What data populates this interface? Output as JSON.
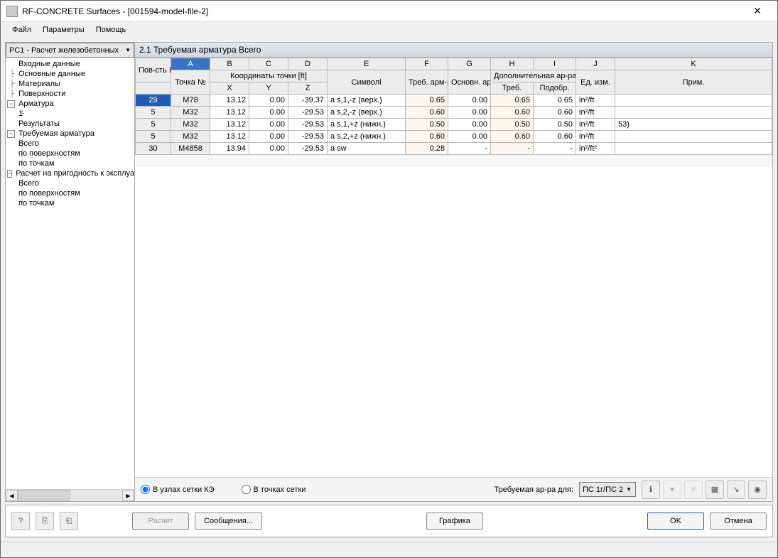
{
  "window": {
    "title": "RF-CONCRETE Surfaces - [001594-model-file-2]"
  },
  "menu": {
    "file": "Файл",
    "params": "Параметры",
    "help": "Помощь"
  },
  "sidebar": {
    "combo": "РС1 - Расчет железобетонных",
    "nodes": {
      "input": "Входные данные",
      "basic": "Основные данные",
      "materials": "Материалы",
      "surfaces": "Поверхности",
      "reinf": "Арматура",
      "reinf1": "1",
      "results": "Результаты",
      "reqreinf": "Требуемая арматура",
      "total1": "Всего",
      "bysurf1": "по поверхностям",
      "bypoint1": "по точкам",
      "service": "Расчет на пригодность к эксплуатации",
      "total2": "Всего",
      "bysurf2": "по поверхностям",
      "bypoint2": "по точкам"
    }
  },
  "panel": {
    "title": "2.1 Требуемая арматура Всего",
    "colLetters": [
      "A",
      "B",
      "C",
      "D",
      "E",
      "F",
      "G",
      "H",
      "I",
      "J",
      "K"
    ],
    "headers": {
      "surface": "Пов-сть №",
      "point": "Точка №",
      "coords": "Координаты точки [ft]",
      "X": "X",
      "Y": "Y",
      "Z": "Z",
      "symbol": "Символl",
      "reqreinf": "Треб. арм-ра",
      "basereinf": "Основн. ар-ра",
      "addreinf": "Дополнительная ар-ра",
      "addreq": "Треб.",
      "addsel": "Подобр.",
      "unit": "Ед. изм.",
      "note": "Прим."
    },
    "rows": [
      {
        "surf": "29",
        "pt": "M78",
        "x": "13.12",
        "y": "0.00",
        "z": "-39.37",
        "sym": "a s,1,-z (верх.)",
        "req": "0.65",
        "base": "0.00",
        "areq": "0.65",
        "asel": "0.65",
        "unit": "in²/ft",
        "note": ""
      },
      {
        "surf": "5",
        "pt": "M32",
        "x": "13.12",
        "y": "0.00",
        "z": "-29.53",
        "sym": "a s,2,-z (верх.)",
        "req": "0.60",
        "base": "0.00",
        "areq": "0.60",
        "asel": "0.60",
        "unit": "in²/ft",
        "note": ""
      },
      {
        "surf": "5",
        "pt": "M32",
        "x": "13.12",
        "y": "0.00",
        "z": "-29.53",
        "sym": "a s,1,+z (нижн.)",
        "req": "0.50",
        "base": "0.00",
        "areq": "0.50",
        "asel": "0.50",
        "unit": "in²/ft",
        "note": "53)"
      },
      {
        "surf": "5",
        "pt": "M32",
        "x": "13.12",
        "y": "0.00",
        "z": "-29.53",
        "sym": "a s,2,+z (нижн.)",
        "req": "0.60",
        "base": "0.00",
        "areq": "0.60",
        "asel": "0.60",
        "unit": "in²/ft",
        "note": ""
      },
      {
        "surf": "30",
        "pt": "M4858",
        "x": "13.94",
        "y": "0.00",
        "z": "-29.53",
        "sym": "a sw",
        "req": "0.28",
        "base": "-",
        "areq": "-",
        "asel": "-",
        "unit": "in²/ft²",
        "note": ""
      }
    ]
  },
  "bottombar": {
    "radio1": "В узлах сетки КЭ",
    "radio2": "В точках сетки",
    "reqlabel": "Требуемая ар-ра для:",
    "select": "ПС 1г/ПС 2"
  },
  "footer": {
    "calc": "Расчет",
    "msgs": "Сообщения...",
    "graphics": "Графика",
    "ok": "OK",
    "cancel": "Отмена"
  }
}
